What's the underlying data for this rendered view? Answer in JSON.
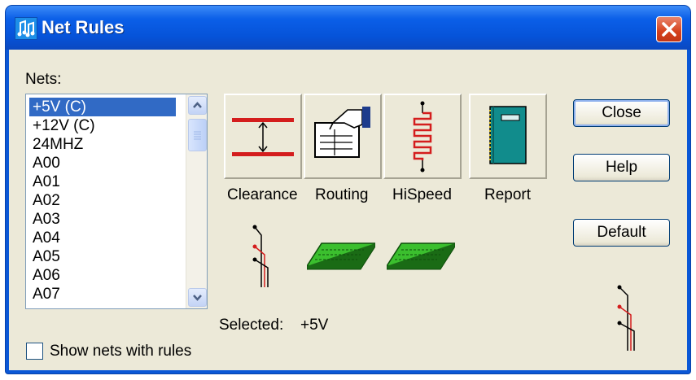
{
  "window": {
    "title": "Net Rules"
  },
  "nets": {
    "label": "Nets:",
    "items": [
      "+5V  (C)",
      "+12V  (C)",
      "24MHZ",
      "A00",
      "A01",
      "A02",
      "A03",
      "A04",
      "A05",
      "A06",
      "A07"
    ],
    "selected_index": 0
  },
  "rule_buttons": [
    {
      "label": "Clearance",
      "icon": "clearance-icon"
    },
    {
      "label": "Routing",
      "icon": "routing-hand-icon"
    },
    {
      "label": "HiSpeed",
      "icon": "hispeed-resistor-icon"
    },
    {
      "label": "Report",
      "icon": "report-book-icon"
    }
  ],
  "selected": {
    "label": "Selected:",
    "value": "+5V"
  },
  "show_nets_with_rules": {
    "label": "Show nets with rules",
    "checked": false
  },
  "actions": {
    "close": "Close",
    "help": "Help",
    "default": "Default"
  }
}
